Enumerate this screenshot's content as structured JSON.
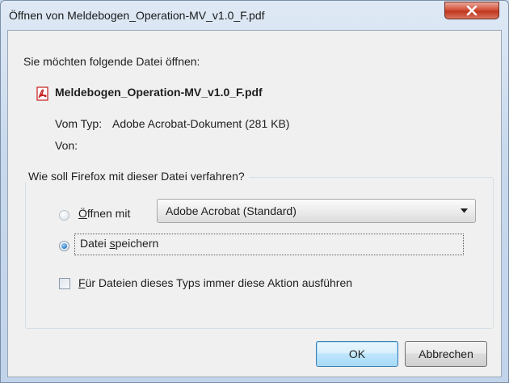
{
  "window": {
    "title": "Öffnen von Meldebogen_Operation-MV_v1.0_F.pdf"
  },
  "dialog": {
    "prompt": "Sie möchten folgende Datei öffnen:",
    "file": {
      "icon": "pdf-file-icon",
      "name": "Meldebogen_Operation-MV_v1.0_F.pdf",
      "type_label": "Vom Typ:",
      "type_value": "Adobe Acrobat-Dokument (281 KB)",
      "from_label": "Von:"
    },
    "action_group": {
      "legend": "Wie soll Firefox mit dieser Datei verfahren?",
      "open_with": {
        "label_first": "Ö",
        "label_rest": "ffnen mit",
        "selected": false,
        "app_value": "Adobe Acrobat  (Standard)"
      },
      "save_file": {
        "label_before": "Datei ",
        "label_underlined": "s",
        "label_after": "peichern",
        "selected": true
      },
      "always_checkbox": {
        "label_first": "F",
        "label_rest": "ür Dateien dieses Typs immer diese Aktion ausführen",
        "checked": false
      }
    },
    "buttons": {
      "ok": "OK",
      "cancel": "Abbrechen"
    }
  },
  "colors": {
    "window_frame": "#c8d9ed",
    "close_button": "#c0361f",
    "dialog_bg": "#f0f0f0",
    "radio_selected": "#2a7fcb"
  }
}
